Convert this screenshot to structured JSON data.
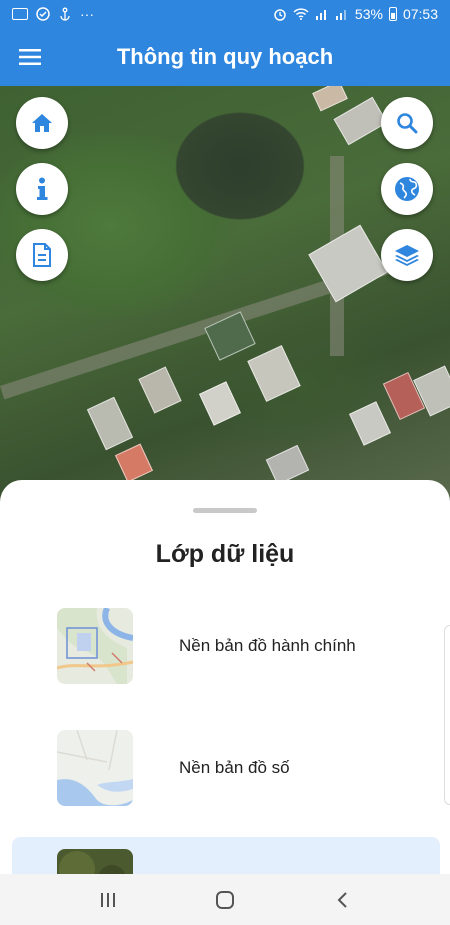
{
  "status_bar": {
    "left_icons": [
      "tile-app-icon",
      "check-circle-icon",
      "anchor-icon",
      "more-dots-icon"
    ],
    "dots": "···",
    "battery_percent": "53%",
    "time": "07:53"
  },
  "app_bar": {
    "title": "Thông tin quy hoạch",
    "menu_icon": "hamburger-menu-icon"
  },
  "map_controls": {
    "left": [
      "home-icon",
      "info-icon",
      "document-icon"
    ],
    "right": [
      "search-icon",
      "globe-icon",
      "layers-icon"
    ]
  },
  "sheet": {
    "title": "Lớp dữ liệu",
    "layers": [
      {
        "label": "Nền bản đồ hành chính",
        "selected": false
      },
      {
        "label": "Nền bản đồ số",
        "selected": false
      },
      {
        "label": "",
        "selected": true
      }
    ]
  },
  "nav_bar": {
    "buttons": [
      "recent-apps-icon",
      "home-button-icon",
      "back-icon"
    ]
  },
  "colors": {
    "primary": "#2f86de",
    "selected_row": "#e4effd"
  }
}
